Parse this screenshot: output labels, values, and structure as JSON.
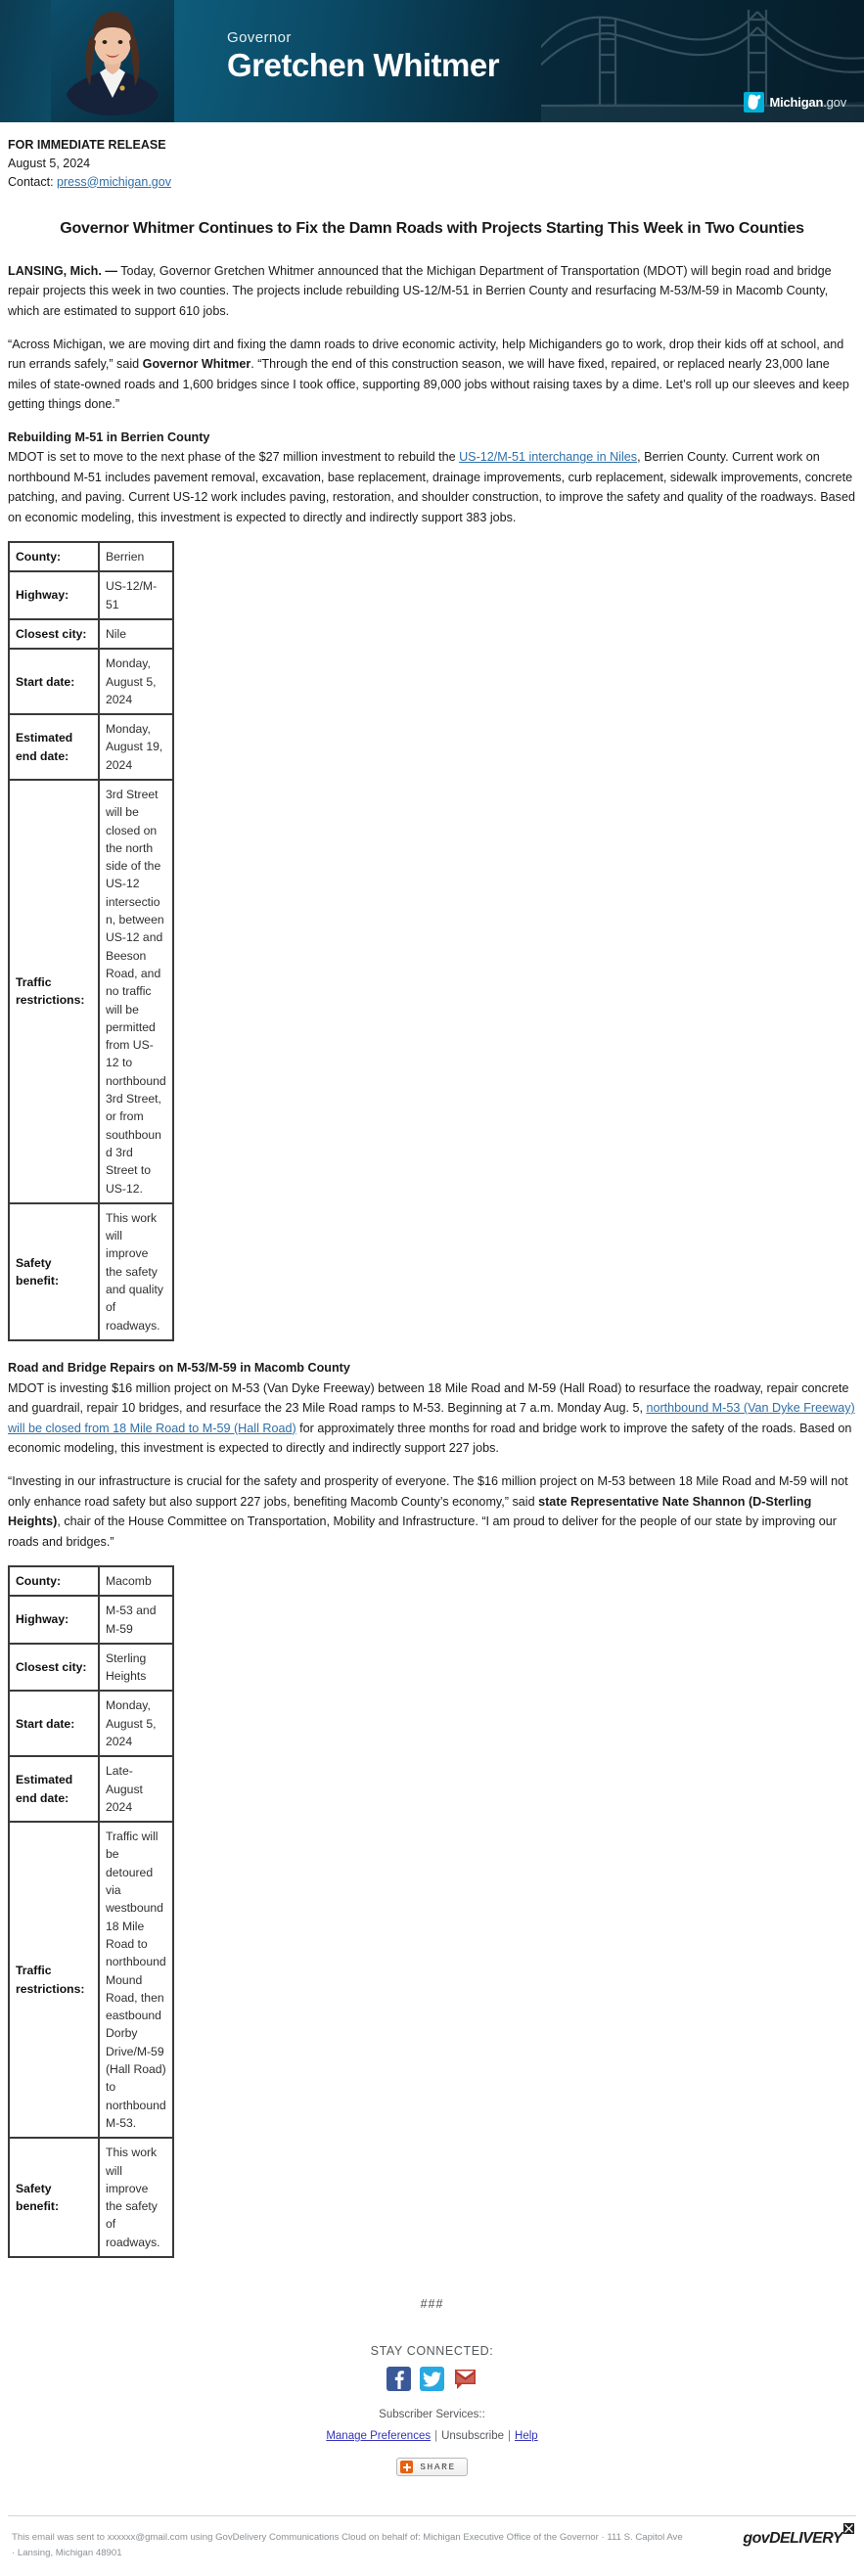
{
  "banner": {
    "eyebrow": "Governor",
    "name": "Gretchen Whitmer",
    "logo_text": "Michigan",
    "logo_suffix": ".gov",
    "portrait_alt": "governor-portrait",
    "accent_color": "#00afd8",
    "background_color": "#0b4a66"
  },
  "release": {
    "immediate_label": "FOR IMMEDIATE RELEASE",
    "date": "August 5, 2024",
    "contact_label": "Contact:",
    "contact_email": "press@michigan.gov"
  },
  "headline": "Governor Whitmer Continues to Fix the Damn Roads with Projects Starting This Week in Two Counties",
  "body": {
    "dateline": "LANSING, Mich. —",
    "lede": " Today, Governor Gretchen Whitmer announced that the Michigan Department of Transportation (MDOT) will begin road and bridge repair projects this week in two counties. The projects include rebuilding US-12/M-51 in Berrien County and resurfacing M-53/M-59 in Macomb County, which are estimated to support 610 jobs.",
    "quote1_part1": "“Across Michigan, we are moving dirt and fixing the damn roads to drive economic activity, help Michiganders go to work, drop their kids off at school, and run errands safely,” said ",
    "quote1_attrib": "Governor Whitmer",
    "quote1_part2": ". “Through the end of this construction season, we will have fixed, repaired, or replaced nearly 23,000 lane miles of state-owned roads and 1,600 bridges since I took office, supporting 89,000 jobs without raising taxes by a dime. Let’s roll up our sleeves and keep getting things done.”"
  },
  "section_berrien": {
    "heading": "Rebuilding M-51 in Berrien County",
    "para_part1": "MDOT is set to move to the next phase of the $27 million investment to rebuild the ",
    "link_text": "US-12/M-51 interchange in Niles",
    "para_part2": ", Berrien County. Current work on northbound M-51 includes pavement removal, excavation, base replacement, drainage improvements, curb replacement, sidewalk improvements, concrete patching, and paving. Current US-12 work includes paving, restoration, and shoulder construction, to improve the safety and quality of the roadways. Based on economic modeling, this investment is expected to directly and indirectly support 383 jobs."
  },
  "table_berrien": {
    "rows": [
      {
        "key": "County:",
        "value": "Berrien"
      },
      {
        "key": "Highway:",
        "value": "US-12/M-51"
      },
      {
        "key": "Closest city:",
        "value": "Nile"
      },
      {
        "key": "Start date:",
        "value": "Monday, August 5, 2024"
      },
      {
        "key": "Estimated end date:",
        "value": "Monday, August 19, 2024"
      },
      {
        "key": "Traffic restrictions:",
        "value": "3rd Street will be closed on the north side of the US-12 intersection, between US-12 and Beeson Road, and no traffic will be permitted from US-12 to northbound 3rd Street, or from southbound 3rd Street to US-12."
      },
      {
        "key": "Safety benefit:",
        "value": "This work will improve the safety and quality of roadways."
      }
    ]
  },
  "section_macomb": {
    "heading": "Road and Bridge Repairs on M-53/M-59 in Macomb County",
    "para_part1": "MDOT is investing $16 million project on M-53 (Van Dyke Freeway) between 18 Mile Road and M-59 (Hall Road) to resurface the roadway, repair concrete and guardrail, repair 10 bridges, and resurface the 23 Mile Road ramps to M-53. Beginning at 7 a.m. Monday Aug. 5, ",
    "link_text": "northbound M-53 (Van Dyke Freeway) will be closed from 18 Mile Road to M-59 (Hall Road)",
    "para_part2": " for approximately three months for road and bridge work to improve the safety of the roads. Based on economic modeling, this investment is expected to directly and indirectly support 227 jobs.",
    "quote_part1": "“Investing in our infrastructure is crucial for the safety and prosperity of everyone. The $16 million project on M-53 between 18 Mile Road and M-59 will not only enhance road safety but also support 227 jobs, benefiting Macomb County’s economy,” said ",
    "quote_attrib": "state Representative Nate Shannon (D-Sterling Heights)",
    "quote_part2": ", chair of the House Committee on Transportation, Mobility and Infrastructure. “I am proud to deliver for the people of our state by improving our roads and bridges.”"
  },
  "table_macomb": {
    "rows": [
      {
        "key": "County:",
        "value": "Macomb"
      },
      {
        "key": "Highway:",
        "value": "M-53 and M-59"
      },
      {
        "key": "Closest city:",
        "value": "Sterling Heights"
      },
      {
        "key": "Start date:",
        "value": "Monday, August 5, 2024"
      },
      {
        "key": "Estimated end date:",
        "value": "Late-August 2024"
      },
      {
        "key": "Traffic restrictions:",
        "value": "Traffic will be detoured via westbound 18 Mile Road to northbound Mound Road, then eastbound Dorby Drive/M-59 (Hall Road) to northbound M-53."
      },
      {
        "key": "Safety benefit:",
        "value": "This work will improve the safety of roadways."
      }
    ]
  },
  "footer": {
    "endmark": "###",
    "stay_connected": "STAY CONNECTED:",
    "social": [
      {
        "name": "facebook-icon",
        "label": "Facebook",
        "color": "#3b5998"
      },
      {
        "name": "twitter-icon",
        "label": "Twitter",
        "color": "#29a9e1"
      },
      {
        "name": "email-icon",
        "label": "Email",
        "color": "#c0392b"
      }
    ],
    "subscriber_label": "Subscriber Services::",
    "manage_preferences": "Manage Preferences",
    "unsubscribe": "Unsubscribe",
    "help": "Help",
    "separator": "|",
    "share_label": "SHARE",
    "disclaimer": "This email was sent to xxxxxx@gmail.com using GovDelivery Communications Cloud on behalf of: Michigan Executive Office of the Governor · 111 S. Capitol Ave · Lansing, Michigan 48901",
    "govdelivery": "govDELIVERY"
  }
}
